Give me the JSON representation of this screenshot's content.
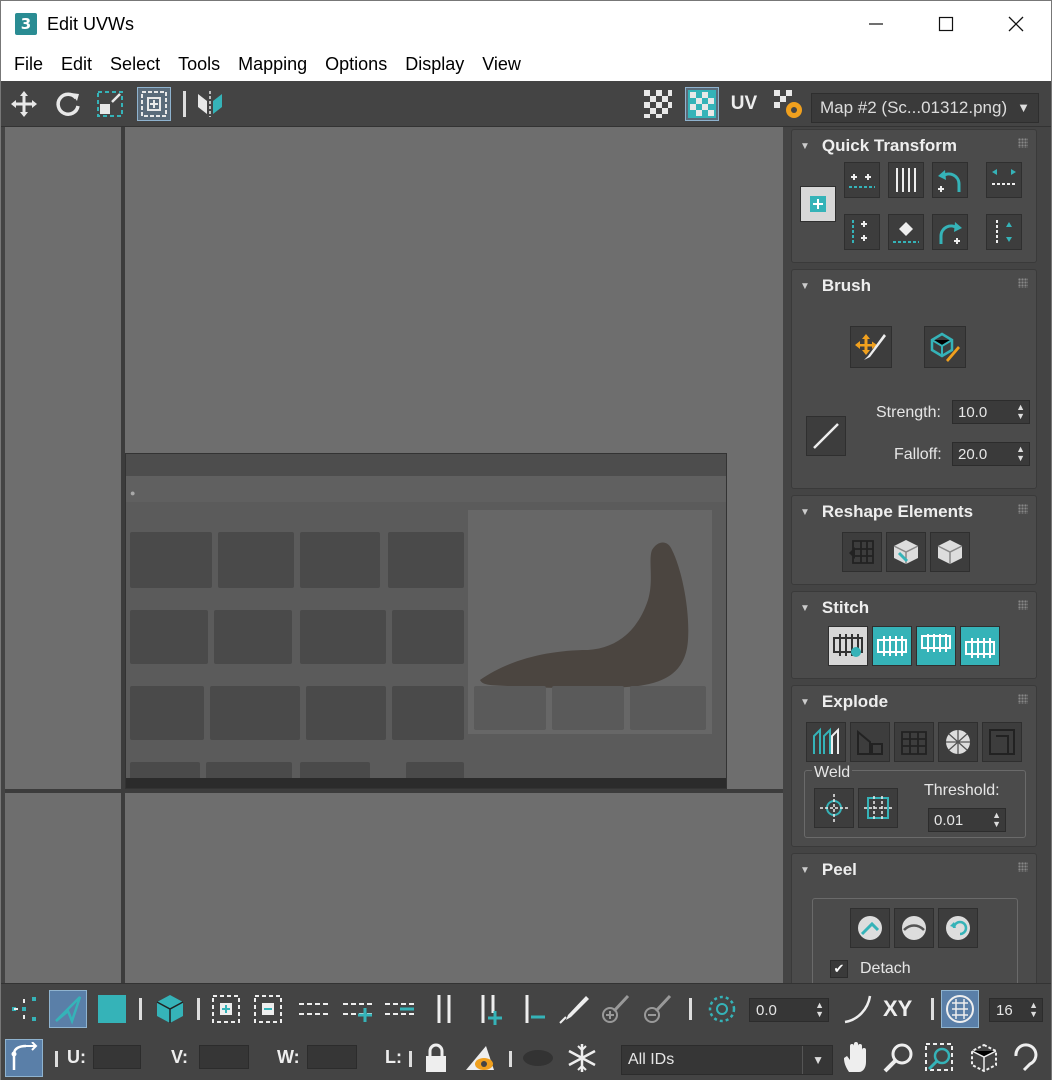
{
  "window": {
    "title": "Edit UVWs",
    "app_icon_glyph": "3",
    "controls": [
      "minimize",
      "maximize",
      "close"
    ]
  },
  "menu": [
    "File",
    "Edit",
    "Select",
    "Tools",
    "Mapping",
    "Options",
    "Display",
    "View"
  ],
  "toolbar": {
    "uv_label": "UV",
    "map_select": "Map #2 (Sc...01312.png)"
  },
  "panel": {
    "quick_transform": {
      "title": "Quick Transform"
    },
    "brush": {
      "title": "Brush",
      "strength_label": "Strength:",
      "strength_value": "10.0",
      "falloff_label": "Falloff:",
      "falloff_value": "20.0"
    },
    "reshape": {
      "title": "Reshape Elements"
    },
    "stitch": {
      "title": "Stitch"
    },
    "explode": {
      "title": "Explode",
      "weld_label": "Weld",
      "threshold_label": "Threshold:",
      "threshold_value": "0.01"
    },
    "peel": {
      "title": "Peel",
      "detach_label": "Detach",
      "detach_checked": true
    }
  },
  "bottom": {
    "angle_value": "0.0",
    "xy_label": "XY",
    "grid_value": "16"
  },
  "status": {
    "u_label": "U:",
    "v_label": "V:",
    "w_label": "W:",
    "l_label": "L:",
    "u_value": "",
    "v_value": "",
    "w_value": "",
    "ids_select": "All IDs"
  },
  "colors": {
    "accent_teal": "#35b3b8",
    "active_blue": "#5a7fa8",
    "panel_bg": "#444444",
    "viewport_bg": "#6e6e6e"
  }
}
